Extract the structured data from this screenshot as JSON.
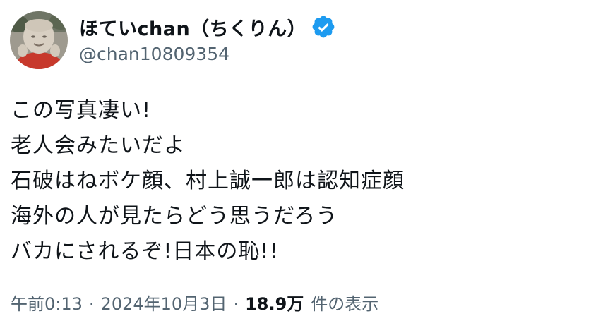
{
  "author": {
    "display_name": "ほていchan（ちくりん）",
    "handle": "@chan10809354",
    "verified_color": "#1d9bf0"
  },
  "tweet": {
    "lines": [
      "この写真凄い!",
      "老人会みたいだよ",
      "石破はねボケ顔、村上誠一郎は認知症顔",
      "海外の人が見たらどう思うだろう",
      "バカにされるぞ!日本の恥!!"
    ]
  },
  "meta": {
    "time": "午前0:13",
    "separator": "·",
    "date": "2024年10月3日",
    "views_count": "18.9万",
    "views_label": "件の表示"
  }
}
